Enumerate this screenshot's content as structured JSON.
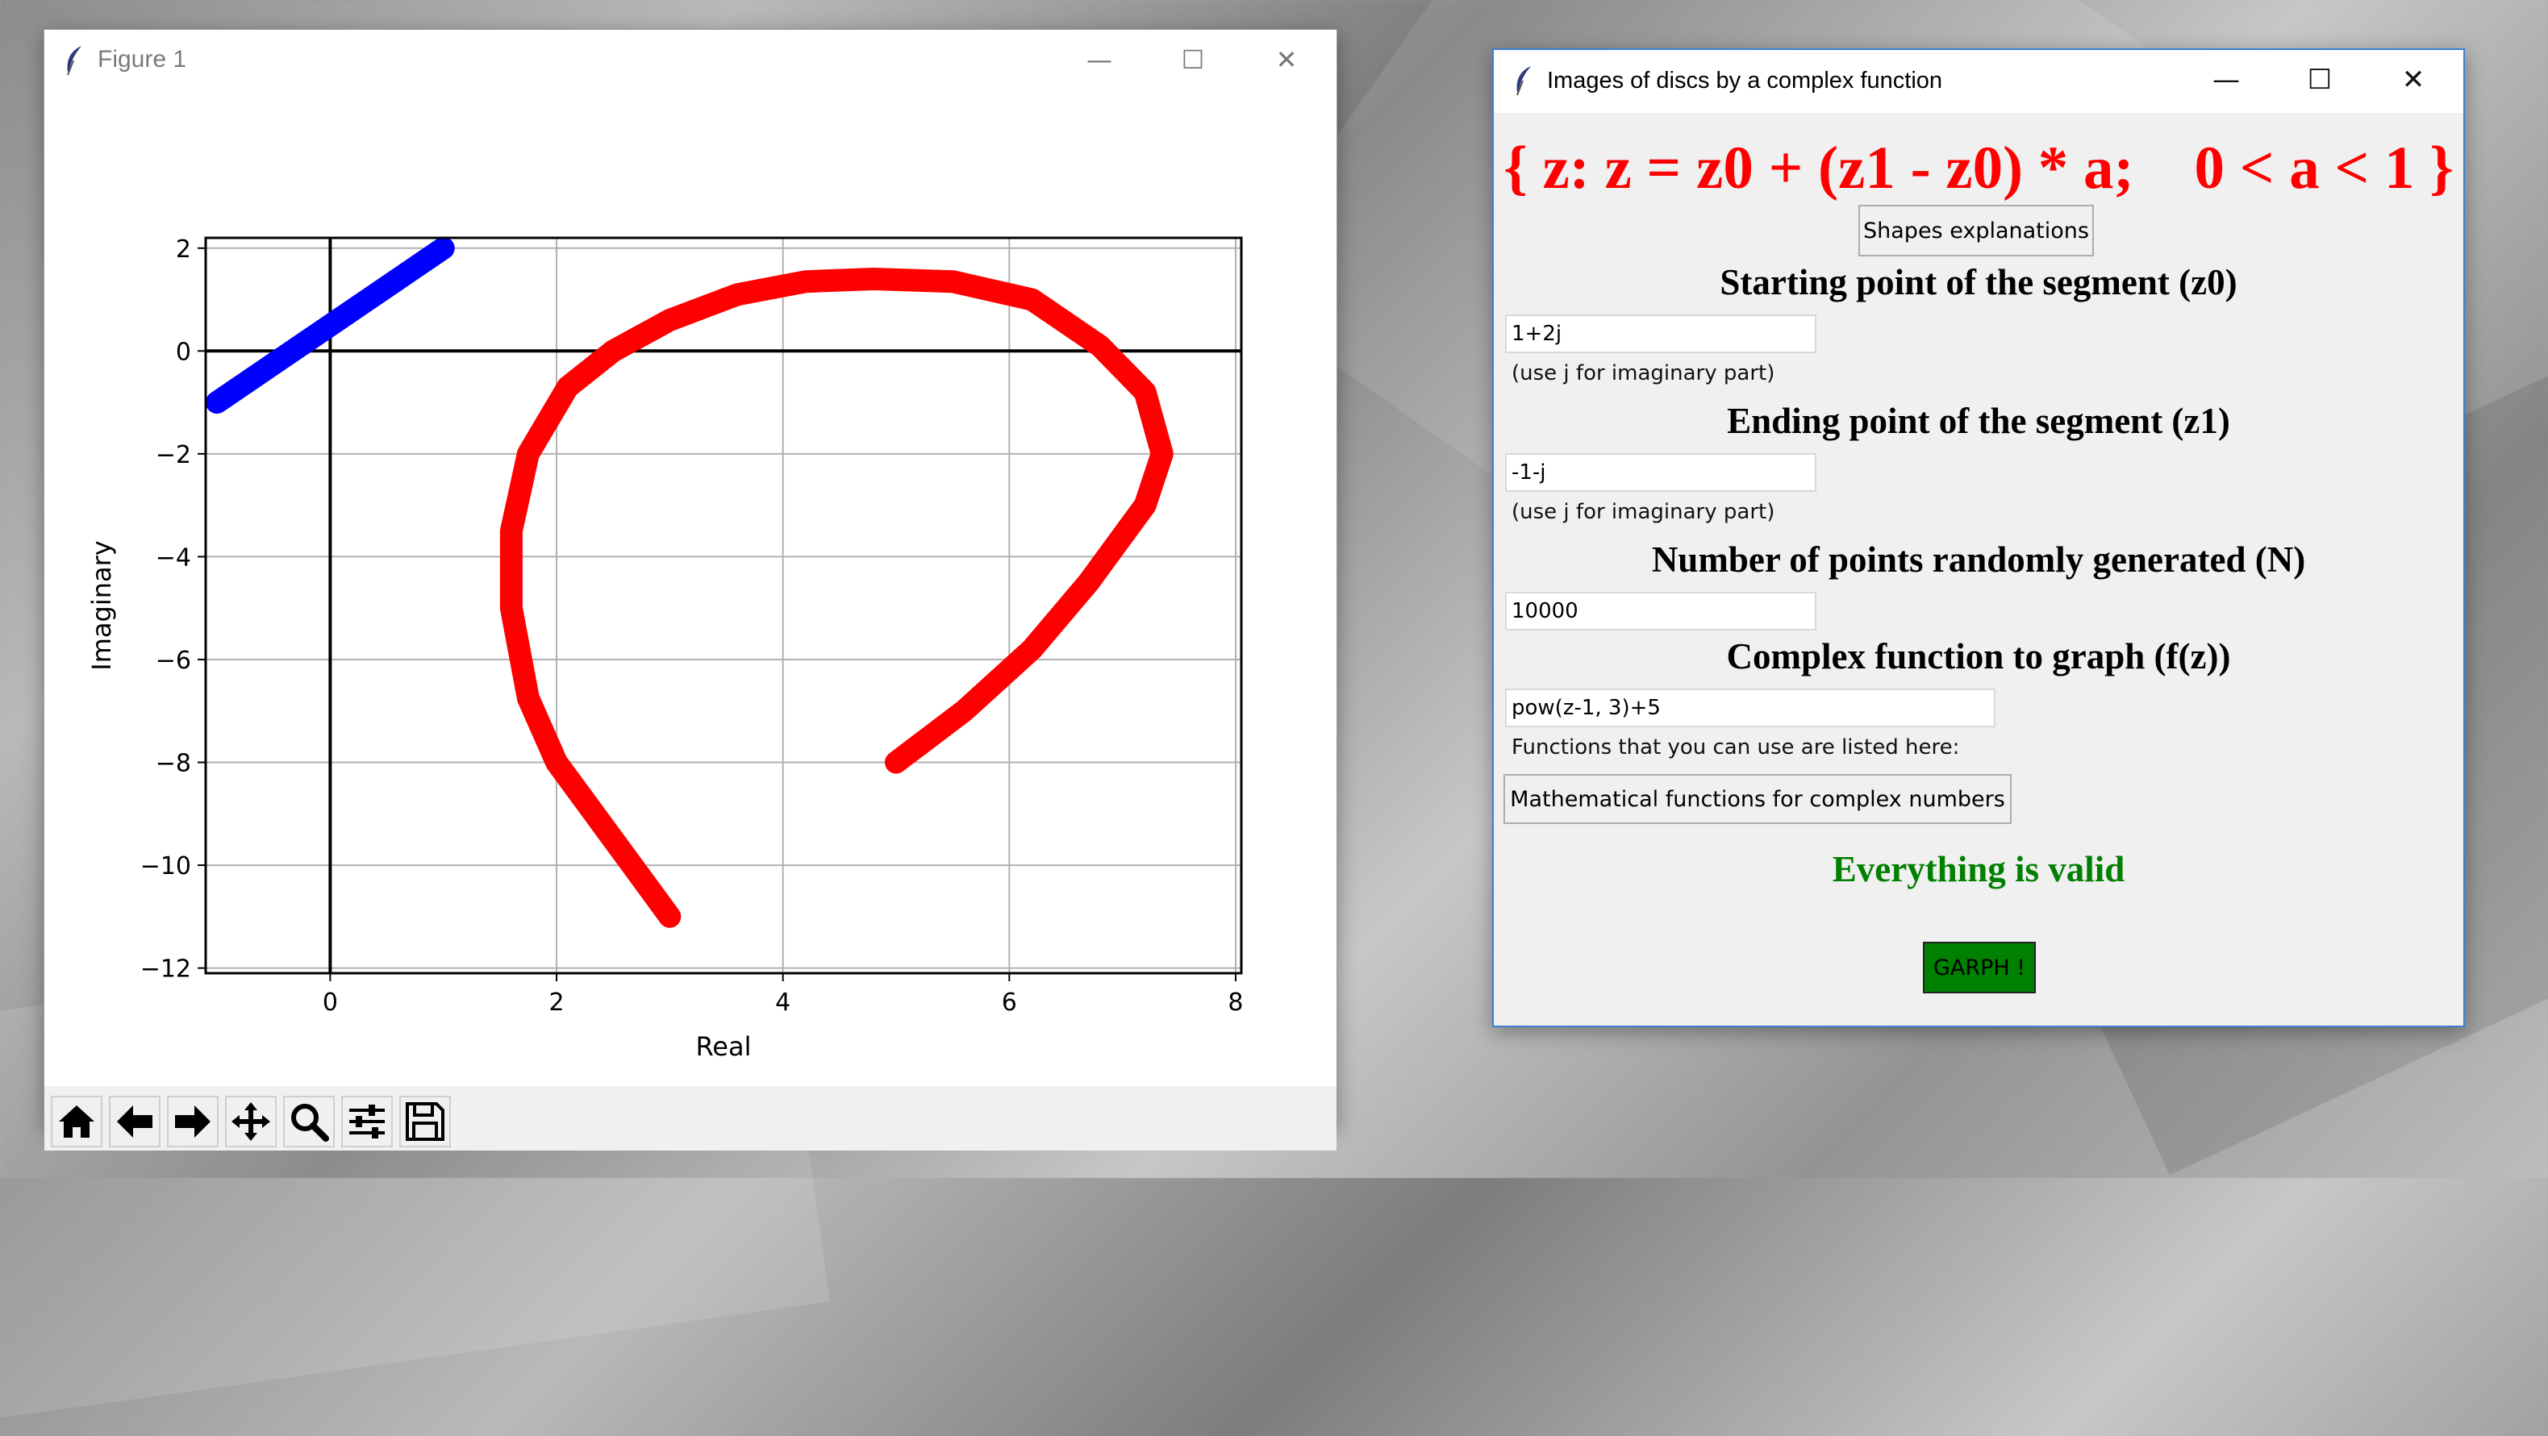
{
  "colors": {
    "segment": "#0000ff",
    "image_curve": "#ff0000",
    "formula_title": "#ff0000",
    "status_valid": "#008000",
    "graph_button_bg": "#008000"
  },
  "figure_window": {
    "title": "Figure 1",
    "controls": {
      "minimize": "—",
      "maximize": "☐",
      "close": "✕"
    },
    "toolbar_icons": [
      "home-icon",
      "back-arrow-icon",
      "forward-arrow-icon",
      "pan-icon",
      "zoom-icon",
      "configure-subplots-icon",
      "save-icon"
    ]
  },
  "chart_data": {
    "type": "scatter",
    "title": "",
    "xlabel": "Real",
    "ylabel": "Imaginary",
    "xlim": [
      -1.1,
      8.05
    ],
    "ylim": [
      -12.1,
      2.2
    ],
    "xticks": [
      0,
      2,
      4,
      6,
      8
    ],
    "yticks": [
      2,
      0,
      -2,
      -4,
      -6,
      -8,
      -10,
      -12
    ],
    "xtick_labels": [
      "0",
      "2",
      "4",
      "6",
      "8"
    ],
    "ytick_labels": [
      "2",
      "0",
      "−2",
      "−4",
      "−6",
      "−8",
      "−10",
      "−12"
    ],
    "grid": true,
    "axes_lines": {
      "x": 0,
      "y": 0
    },
    "series": [
      {
        "color": "#0000ff",
        "points": [
          [
            -1,
            -1
          ],
          [
            1,
            2
          ]
        ]
      },
      {
        "color": "#ff0000",
        "points": [
          [
            3.0,
            -11.0
          ],
          [
            2.75,
            -10.25
          ],
          [
            2.5,
            -9.5
          ],
          [
            2.25,
            -8.75
          ],
          [
            2.0,
            -8.0
          ],
          [
            1.75,
            -6.75
          ],
          [
            1.6,
            -5.0
          ],
          [
            1.6,
            -3.5
          ],
          [
            1.75,
            -2.0
          ],
          [
            2.1,
            -0.7
          ],
          [
            2.5,
            0.0
          ],
          [
            3.0,
            0.6
          ],
          [
            3.6,
            1.1
          ],
          [
            4.2,
            1.35
          ],
          [
            4.8,
            1.4
          ],
          [
            5.5,
            1.35
          ],
          [
            6.2,
            1.0
          ],
          [
            6.8,
            0.1
          ],
          [
            7.2,
            -0.8
          ],
          [
            7.35,
            -2.0
          ],
          [
            7.2,
            -3.0
          ],
          [
            6.7,
            -4.5
          ],
          [
            6.2,
            -5.8
          ],
          [
            5.6,
            -7.0
          ],
          [
            5.0,
            -8.0
          ]
        ]
      }
    ]
  },
  "app_window": {
    "title": "Images of discs by a complex function",
    "controls": {
      "minimize": "—",
      "maximize": "☐",
      "close": "✕"
    },
    "formula": "{ z: z = z0 + (z1 - z0) * a;    0 < a < 1 }",
    "shapes_button": "Shapes explanations",
    "start": {
      "heading": "Starting point of the segment (z0)",
      "value": "1+2j",
      "hint": "(use j for imaginary part)"
    },
    "end": {
      "heading": "Ending point of the segment (z1)",
      "value": "-1-j",
      "hint": "(use j for imaginary part)"
    },
    "npoints": {
      "heading": "Number of points randomly generated (N)",
      "value": "10000"
    },
    "function": {
      "heading": "Complex function to graph (f(z))",
      "value": "pow(z-1, 3)+5",
      "hint": "Functions that you can use are listed here:"
    },
    "math_button": "Mathematical functions for complex numbers",
    "status": "Everything is valid",
    "graph_button": "GARPH !"
  }
}
